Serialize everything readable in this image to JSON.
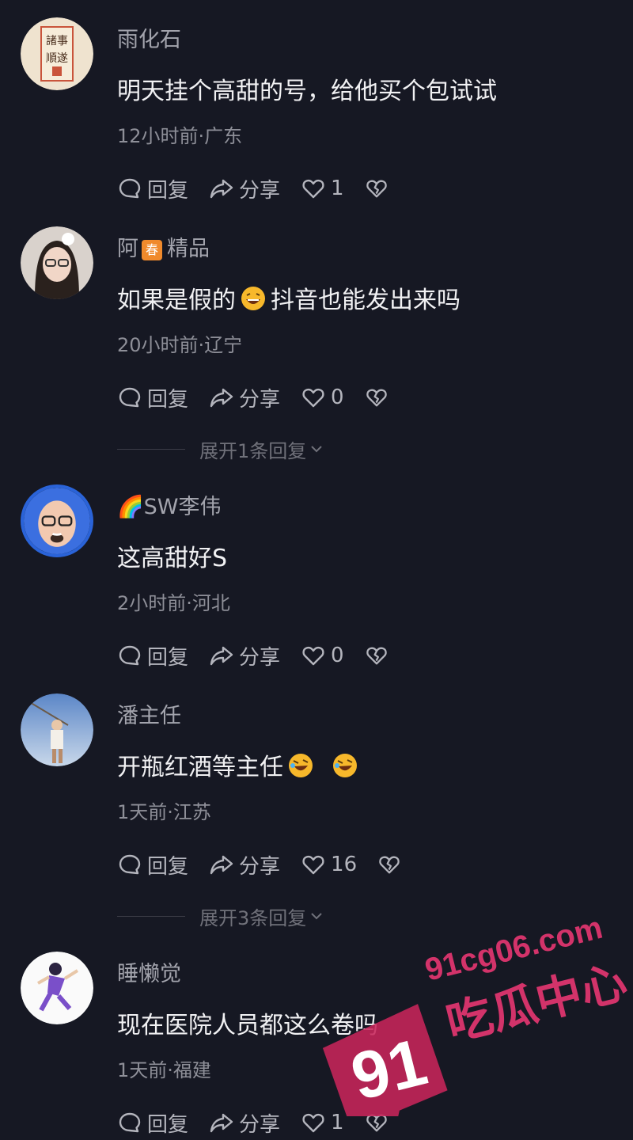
{
  "comments": [
    {
      "user": "雨化石",
      "badge": "",
      "text": "明天挂个高甜的号，给他买个包试试",
      "text_after": "",
      "meta": "12小时前·广东",
      "reply": "回复",
      "share": "分享",
      "likes": "1"
    },
    {
      "user": "阿",
      "badge": "春",
      "user_after": "精品",
      "text": "如果是假的",
      "text_after": "抖音也能发出来吗",
      "meta": "20小时前·辽宁",
      "reply": "回复",
      "share": "分享",
      "likes": "0"
    },
    {
      "user": "🌈SW李伟",
      "badge": "",
      "text": "这高甜好S",
      "text_after": "",
      "meta": "2小时前·河北",
      "reply": "回复",
      "share": "分享",
      "likes": "0"
    },
    {
      "user": "潘主任",
      "badge": "",
      "text": "开瓶红酒等主任",
      "text_after": "",
      "meta": "1天前·江苏",
      "reply": "回复",
      "share": "分享",
      "likes": "16"
    },
    {
      "user": "睡懒觉",
      "badge": "",
      "text": "现在医院人员都这么卷吗",
      "text_after": "",
      "meta": "1天前·福建",
      "reply": "回复",
      "share": "分享",
      "likes": "1"
    }
  ],
  "expand_replies": [
    "展开1条回复",
    "展开3条回复"
  ],
  "watermark": {
    "site": "91cg06.com",
    "brand": "吃瓜中心",
    "logo": "91"
  },
  "colors": {
    "background": "#161823",
    "accent": "#c8245a"
  }
}
